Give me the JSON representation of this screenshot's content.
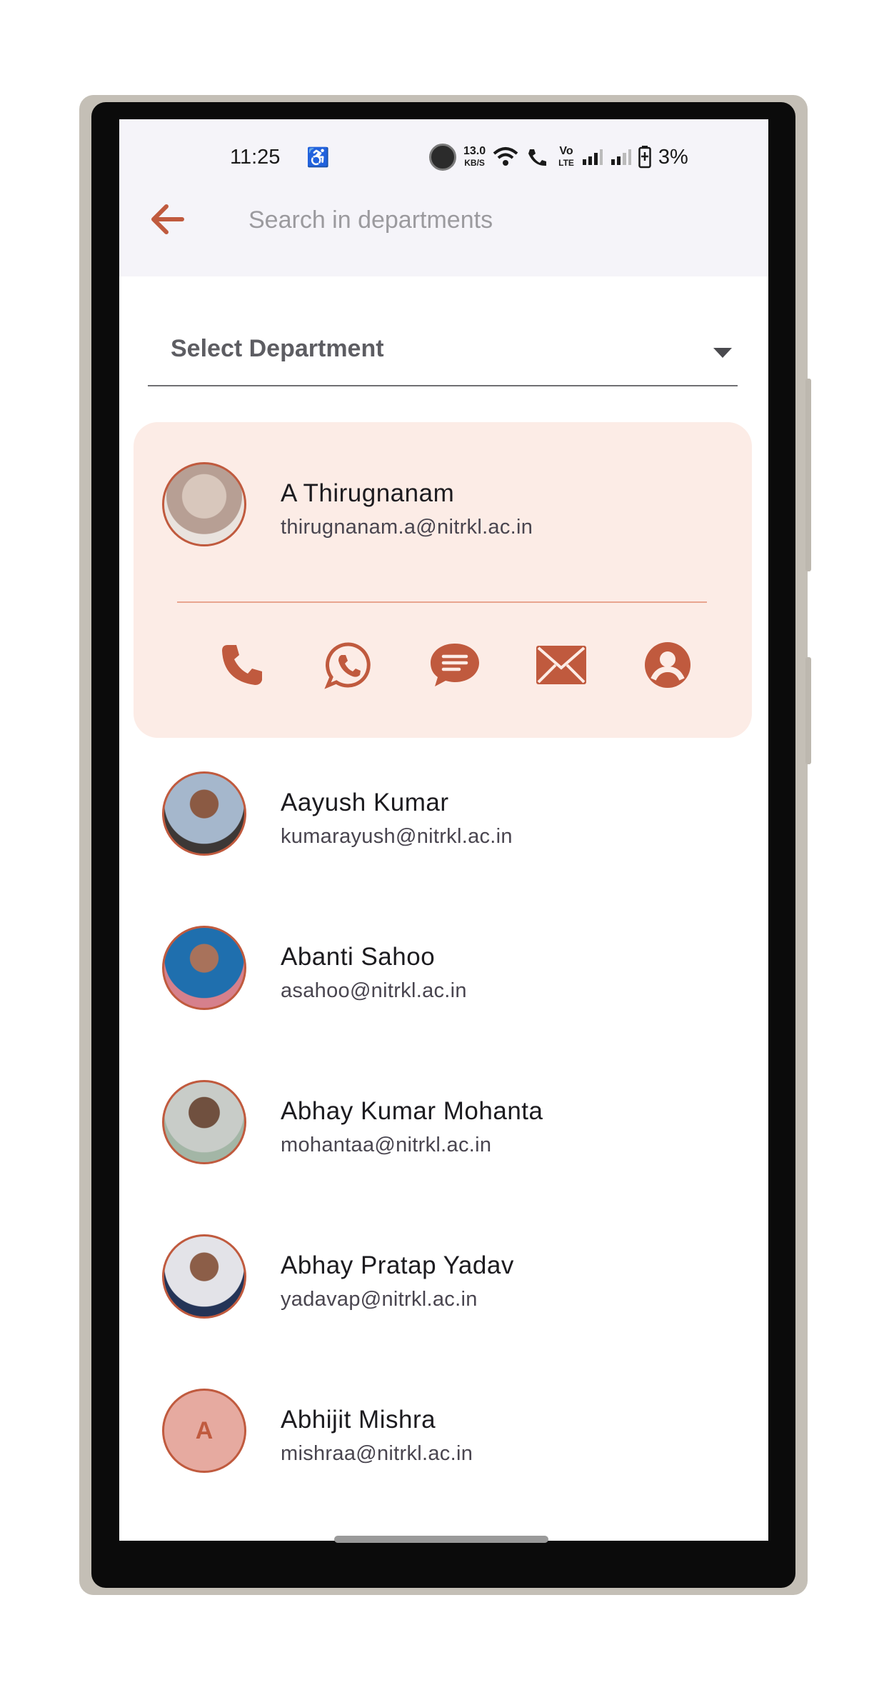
{
  "status_bar": {
    "time": "11:25",
    "net_speed_value": "13.0",
    "net_speed_unit": "KB/S",
    "volte_top": "Vo",
    "volte_bottom": "LTE",
    "battery": "3%"
  },
  "app_bar": {
    "search_placeholder": "Search in departments"
  },
  "department_select": {
    "label": "Select Department"
  },
  "expanded_contact": {
    "name": "A Thirugnanam",
    "email": "thirugnanam.a@nitrkl.ac.in"
  },
  "contacts": [
    {
      "name": "Aayush Kumar",
      "email": "kumarayush@nitrkl.ac.in"
    },
    {
      "name": "Abanti Sahoo",
      "email": "asahoo@nitrkl.ac.in"
    },
    {
      "name": "Abhay Kumar Mohanta",
      "email": "mohantaa@nitrkl.ac.in"
    },
    {
      "name": "Abhay Pratap Yadav",
      "email": "yadavap@nitrkl.ac.in"
    },
    {
      "name": "Abhijit Mishra",
      "email": "mishraa@nitrkl.ac.in",
      "initial": "A"
    }
  ],
  "colors": {
    "accent": "#c05a3e",
    "card_bg": "#fcece6",
    "appbar_bg": "#f5f4f9"
  },
  "icons": [
    "arrow-back-icon",
    "phone-icon",
    "whatsapp-icon",
    "message-icon",
    "mail-icon",
    "profile-icon",
    "dropdown-arrow-icon"
  ]
}
